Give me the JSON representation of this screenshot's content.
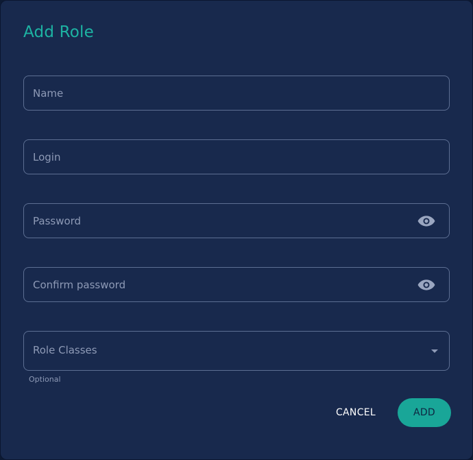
{
  "dialog": {
    "title": "Add Role",
    "fields": {
      "name": {
        "placeholder": "Name",
        "value": ""
      },
      "login": {
        "placeholder": "Login",
        "value": ""
      },
      "password": {
        "placeholder": "Password",
        "value": "",
        "icon": "eye-icon"
      },
      "confirm_password": {
        "placeholder": "Confirm password",
        "value": "",
        "icon": "eye-icon"
      }
    },
    "role_classes": {
      "label": "Role Classes",
      "hint": "Optional",
      "icon": "caret-down-icon"
    },
    "actions": {
      "cancel_label": "CANCEL",
      "add_label": "ADD"
    }
  },
  "colors": {
    "background": "#18294d",
    "accent": "#19a698",
    "title": "#1db3a3",
    "border": "#5d6f93",
    "muted_text": "#8e9ab6"
  }
}
